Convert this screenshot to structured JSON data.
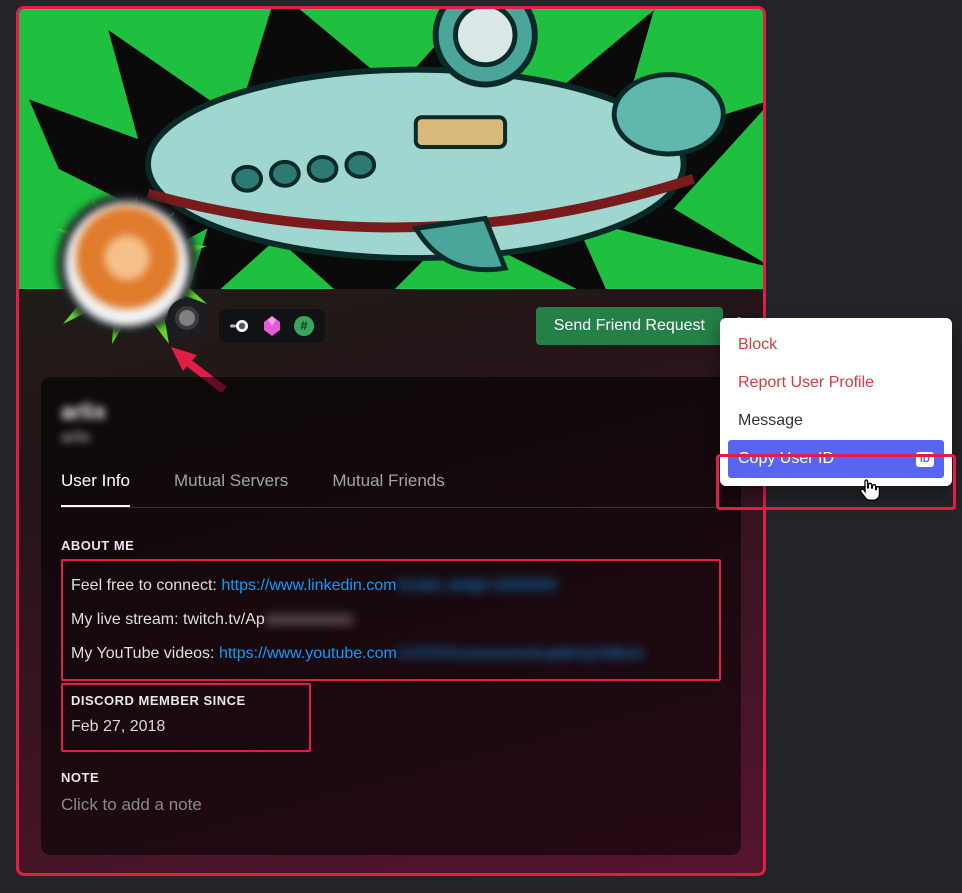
{
  "profile": {
    "display_name": "arlix",
    "username": "arlix",
    "friend_button": "Send Friend Request"
  },
  "badges": {
    "nitro": "nitro-badge",
    "boost": "boost-badge",
    "hash": "originally-known-as-badge"
  },
  "tabs": {
    "user_info": "User Info",
    "mutual_servers": "Mutual Servers",
    "mutual_friends": "Mutual Friends"
  },
  "about": {
    "title": "ABOUT ME",
    "line1_prefix": "Feel free to connect: ",
    "line1_link": "https://www.linkedin.com",
    "line1_redacted_tail": "/in/abc-defgh-0000000",
    "line2_prefix": "My live stream: twitch.tv/Ap",
    "line2_redacted_tail": "xxxxxxxxxxx",
    "line3_prefix": "My YouTube videos: ",
    "line3_link": "https://www.youtube.com",
    "line3_redacted_tail": "/c/XXXXxxxxxxxxxAcademyVideos"
  },
  "member_since": {
    "title": "DISCORD MEMBER SINCE",
    "date": "Feb 27, 2018"
  },
  "note": {
    "title": "NOTE",
    "placeholder": "Click to add a note"
  },
  "context_menu": {
    "block": "Block",
    "report": "Report User Profile",
    "message": "Message",
    "copy_id": "Copy User ID",
    "id_badge": "ID"
  }
}
